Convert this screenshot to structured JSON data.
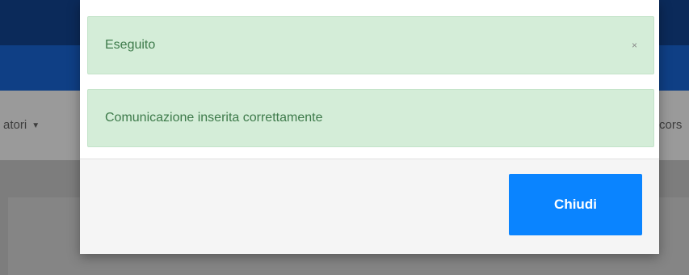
{
  "background": {
    "nav_left_label": "atori",
    "nav_right_label": "cors"
  },
  "modal": {
    "alert_title": "Eseguito",
    "alert_close_glyph": "×",
    "alert_message": "Comunicazione inserita correttamente",
    "close_button_label": "Chiudi"
  },
  "colors": {
    "header_dark": "#0b2a5a",
    "header_blue": "#0f3f85",
    "alert_bg": "#d4edd8",
    "alert_text": "#3d7a4a",
    "primary_button": "#0a84ff"
  }
}
